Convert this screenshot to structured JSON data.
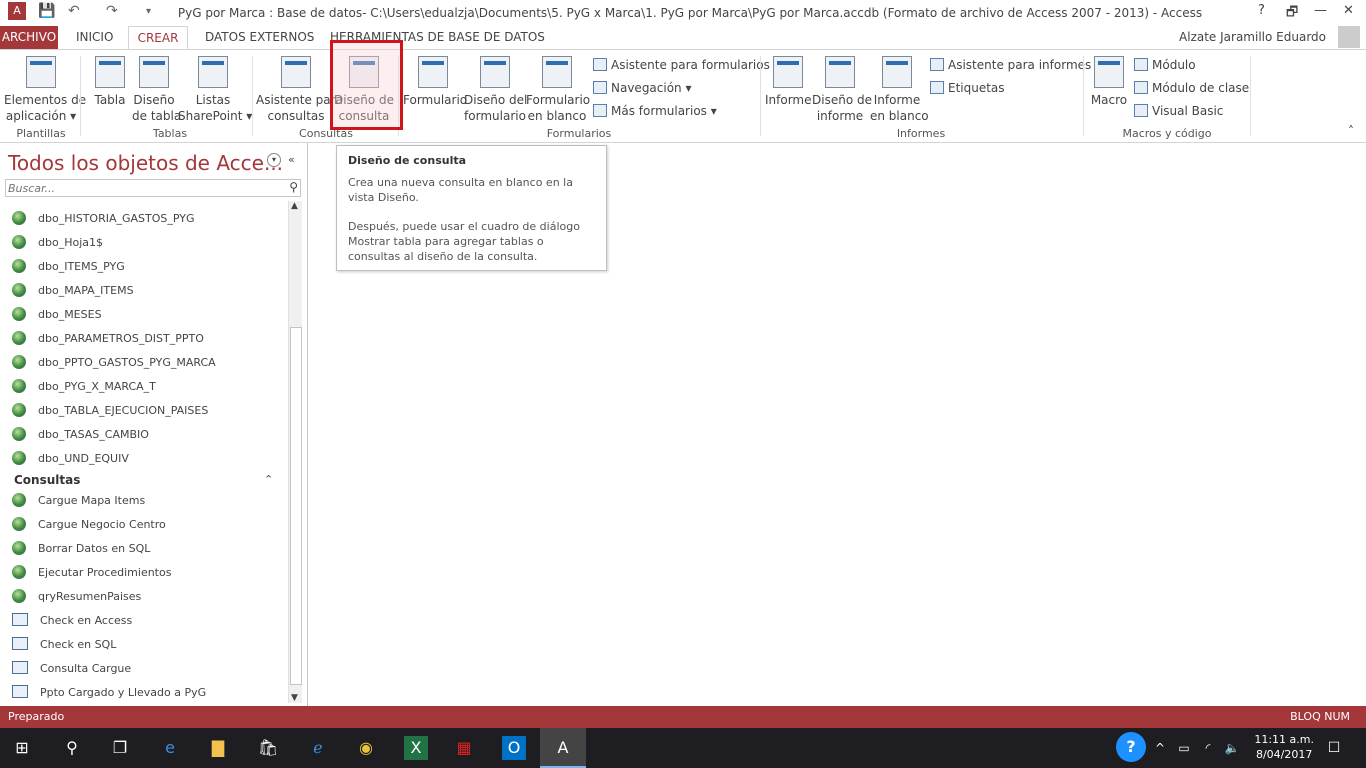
{
  "titlebar": {
    "title": "PyG por Marca : Base de datos- C:\\Users\\edualzja\\Documents\\5. PyG x Marca\\1. PyG por Marca\\PyG por Marca.accdb (Formato de archivo de Access 2007 - 2013) - Access",
    "help": "?",
    "restore": "🗗",
    "minimize": "—",
    "maximize": "🗖",
    "close": "✕"
  },
  "tabs": {
    "archivo": "ARCHIVO",
    "inicio": "INICIO",
    "crear": "CREAR",
    "datos_externos": "DATOS EXTERNOS",
    "herramientas": "HERRAMIENTAS DE BASE DE DATOS",
    "user": "Alzate Jaramillo Eduardo"
  },
  "ribbon": {
    "plantillas": {
      "btn": "Elementos de\naplicación ▾",
      "group": "Plantillas"
    },
    "tablas": {
      "tabla": "Tabla",
      "diseno": "Diseño\nde tabla",
      "listas": "Listas\nSharePoint ▾",
      "group": "Tablas"
    },
    "consultas": {
      "asistente": "Asistente para\nconsultas",
      "diseno": "Diseño de\nconsulta",
      "group": "Consultas"
    },
    "formularios": {
      "formulario": "Formulario",
      "diseno": "Diseño del\nformulario",
      "blanco": "Formulario\nen blanco",
      "asistente": "Asistente para formularios",
      "navegacion": "Navegación ▾",
      "mas": "Más formularios ▾",
      "group": "Formularios"
    },
    "informes": {
      "informe": "Informe",
      "diseno": "Diseño de\ninforme",
      "blanco": "Informe\nen blanco",
      "asistente": "Asistente para informes",
      "etiquetas": "Etiquetas",
      "group": "Informes"
    },
    "macros": {
      "macro": "Macro",
      "modulo": "Módulo",
      "clase": "Módulo de clase",
      "vb": "Visual Basic",
      "group": "Macros y código"
    }
  },
  "nav": {
    "title": "Todos los objetos de Acce...",
    "search_placeholder": "Buscar...",
    "tables": [
      "dbo_HISTORIA_GASTOS_PYG",
      "dbo_Hoja1$",
      "dbo_ITEMS_PYG",
      "dbo_MAPA_ITEMS",
      "dbo_MESES",
      "dbo_PARAMETROS_DIST_PPTO",
      "dbo_PPTO_GASTOS_PYG_MARCA",
      "dbo_PYG_X_MARCA_T",
      "dbo_TABLA_EJECUCION_PAISES",
      "dbo_TASAS_CAMBIO",
      "dbo_UND_EQUIV"
    ],
    "section": "Consultas",
    "queries": [
      "Cargue Mapa Items",
      "Cargue Negocio Centro",
      "Borrar Datos en SQL",
      "Ejecutar Procedimientos",
      "qryResumenPaises",
      "Check en Access",
      "Check en SQL",
      "Consulta Cargue",
      "Ppto Cargado y Llevado a PyG"
    ]
  },
  "tooltip": {
    "title": "Diseño de consulta",
    "p1": "Crea una nueva consulta en blanco en la vista Diseño.",
    "p2": "Después, puede usar el cuadro de diálogo Mostrar tabla para agregar tablas o consultas al diseño de la consulta."
  },
  "status": {
    "left": "Preparado",
    "right": "BLOQ NUM"
  },
  "taskbar": {
    "time": "11:11 a.m.",
    "date": "8/04/2017"
  },
  "colors": {
    "accent": "#a4373a",
    "highlight": "#d0141b"
  }
}
